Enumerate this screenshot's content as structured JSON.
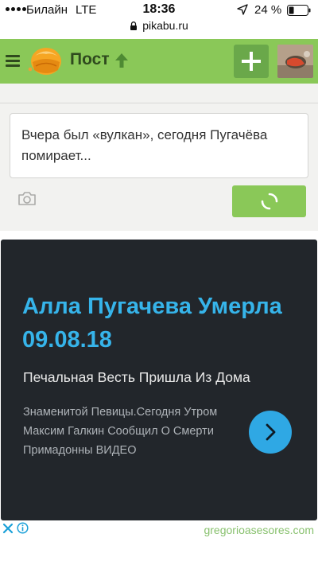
{
  "status_bar": {
    "carrier": "Билайн",
    "network": "LTE",
    "time": "18:36",
    "battery_percent": "24 %",
    "url": "pikabu.ru"
  },
  "header": {
    "title": "Пост",
    "icons": [
      "menu-icon",
      "pikabu-logo-icon",
      "up-arrow-icon",
      "plus-icon"
    ],
    "accent_color": "#8ac858"
  },
  "comment": {
    "text": "Вчера был «вулкан», сегодня Пугачёва помирает...",
    "send_state": "loading"
  },
  "ad": {
    "headline": "Алла Пугачева Умерла 09.08.18",
    "subtitle": "Печальная Весть Пришла Из Дома",
    "body": "Знаменитой Певицы.Сегодня Утром Максим Галкин Сообщил О Смерти Примадонны ВИДЕО",
    "domain": "gregorioasesores.com",
    "background_color": "#22262b",
    "headline_color": "#36b4ea"
  }
}
